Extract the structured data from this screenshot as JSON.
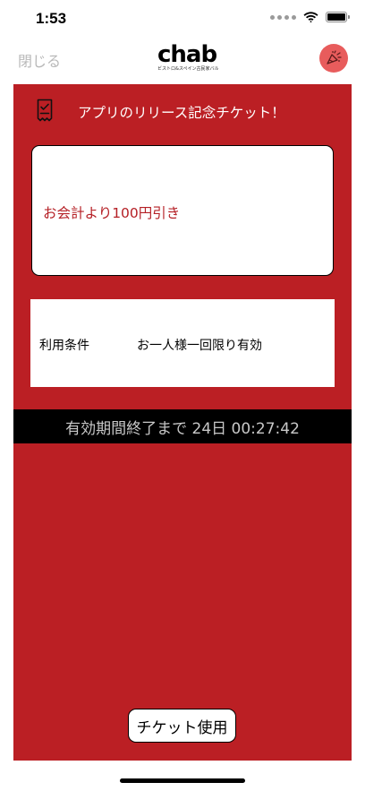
{
  "status_bar": {
    "time": "1:53"
  },
  "nav": {
    "close_label": "閉じる",
    "logo_text": "chab",
    "logo_subtitle": "ビストロ&スペイン古民家バル",
    "avatar_icon": "party-popper-icon",
    "avatar_color": "#e85c5c"
  },
  "ticket": {
    "background_color": "#bb1f24",
    "icon": "receipt-icon",
    "title": "アプリのリリース記念チケット！",
    "discount": "お会計より100円引き",
    "conditions_label": "利用条件",
    "conditions_value": "お一人様一回限り有効",
    "expiry": "有効期間終了まで 24日 00:27:42",
    "use_button_label": "チケット使用"
  }
}
